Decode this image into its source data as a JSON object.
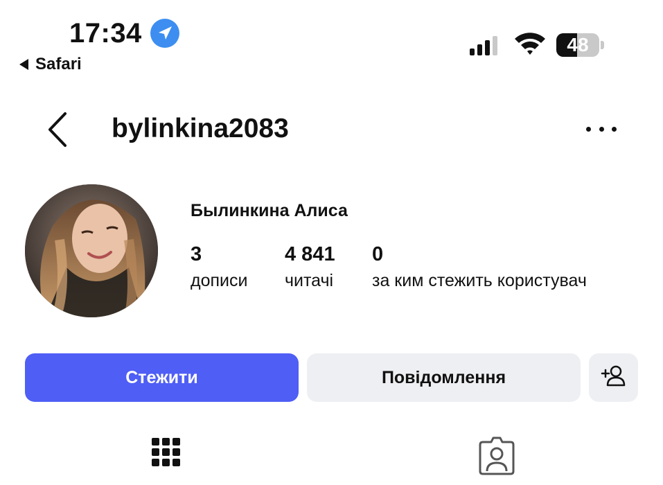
{
  "status_bar": {
    "time": "17:34",
    "back_app": "Safari",
    "battery_percent": "48",
    "location_icon": "location-arrow-icon",
    "signal_icon": "cellular-signal-icon",
    "wifi_icon": "wifi-icon"
  },
  "header": {
    "username": "bylinkina2083",
    "back_icon": "chevron-left-icon",
    "more_icon": "more-dots-icon"
  },
  "profile": {
    "full_name": "Былинкина Алиса",
    "stats": [
      {
        "value": "3",
        "label": "дописи"
      },
      {
        "value": "4 841",
        "label": "читачі"
      },
      {
        "value": "0",
        "label": "за ким стежить користувач"
      }
    ]
  },
  "actions": {
    "follow_label": "Стежити",
    "message_label": "Повідомлення",
    "suggest_icon": "add-person-icon"
  },
  "tabs": {
    "grid_icon": "grid-icon",
    "tagged_icon": "tagged-person-icon"
  },
  "colors": {
    "accent": "#4f5ef5",
    "secondary_button": "#eeeff2",
    "location_blue": "#3d8ef0"
  }
}
